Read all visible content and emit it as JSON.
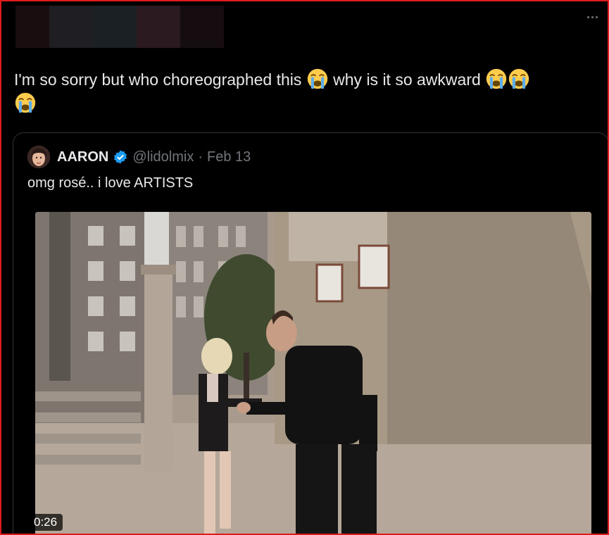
{
  "tweet": {
    "text_part1": "I'm so sorry but who choreographed this ",
    "text_part2": " why is it so awkward ",
    "emoji_name": "loudly-crying-face"
  },
  "quote": {
    "author_name": "AARON",
    "handle": "@lidolmix",
    "separator": "·",
    "date": "Feb 13",
    "text": "omg rosé.. i love ARTISTS",
    "verified": true
  },
  "media": {
    "duration": "0:26"
  },
  "colors": {
    "accent_verified": "#1d9bf0",
    "border": "#e0191c",
    "muted": "#71767b"
  }
}
